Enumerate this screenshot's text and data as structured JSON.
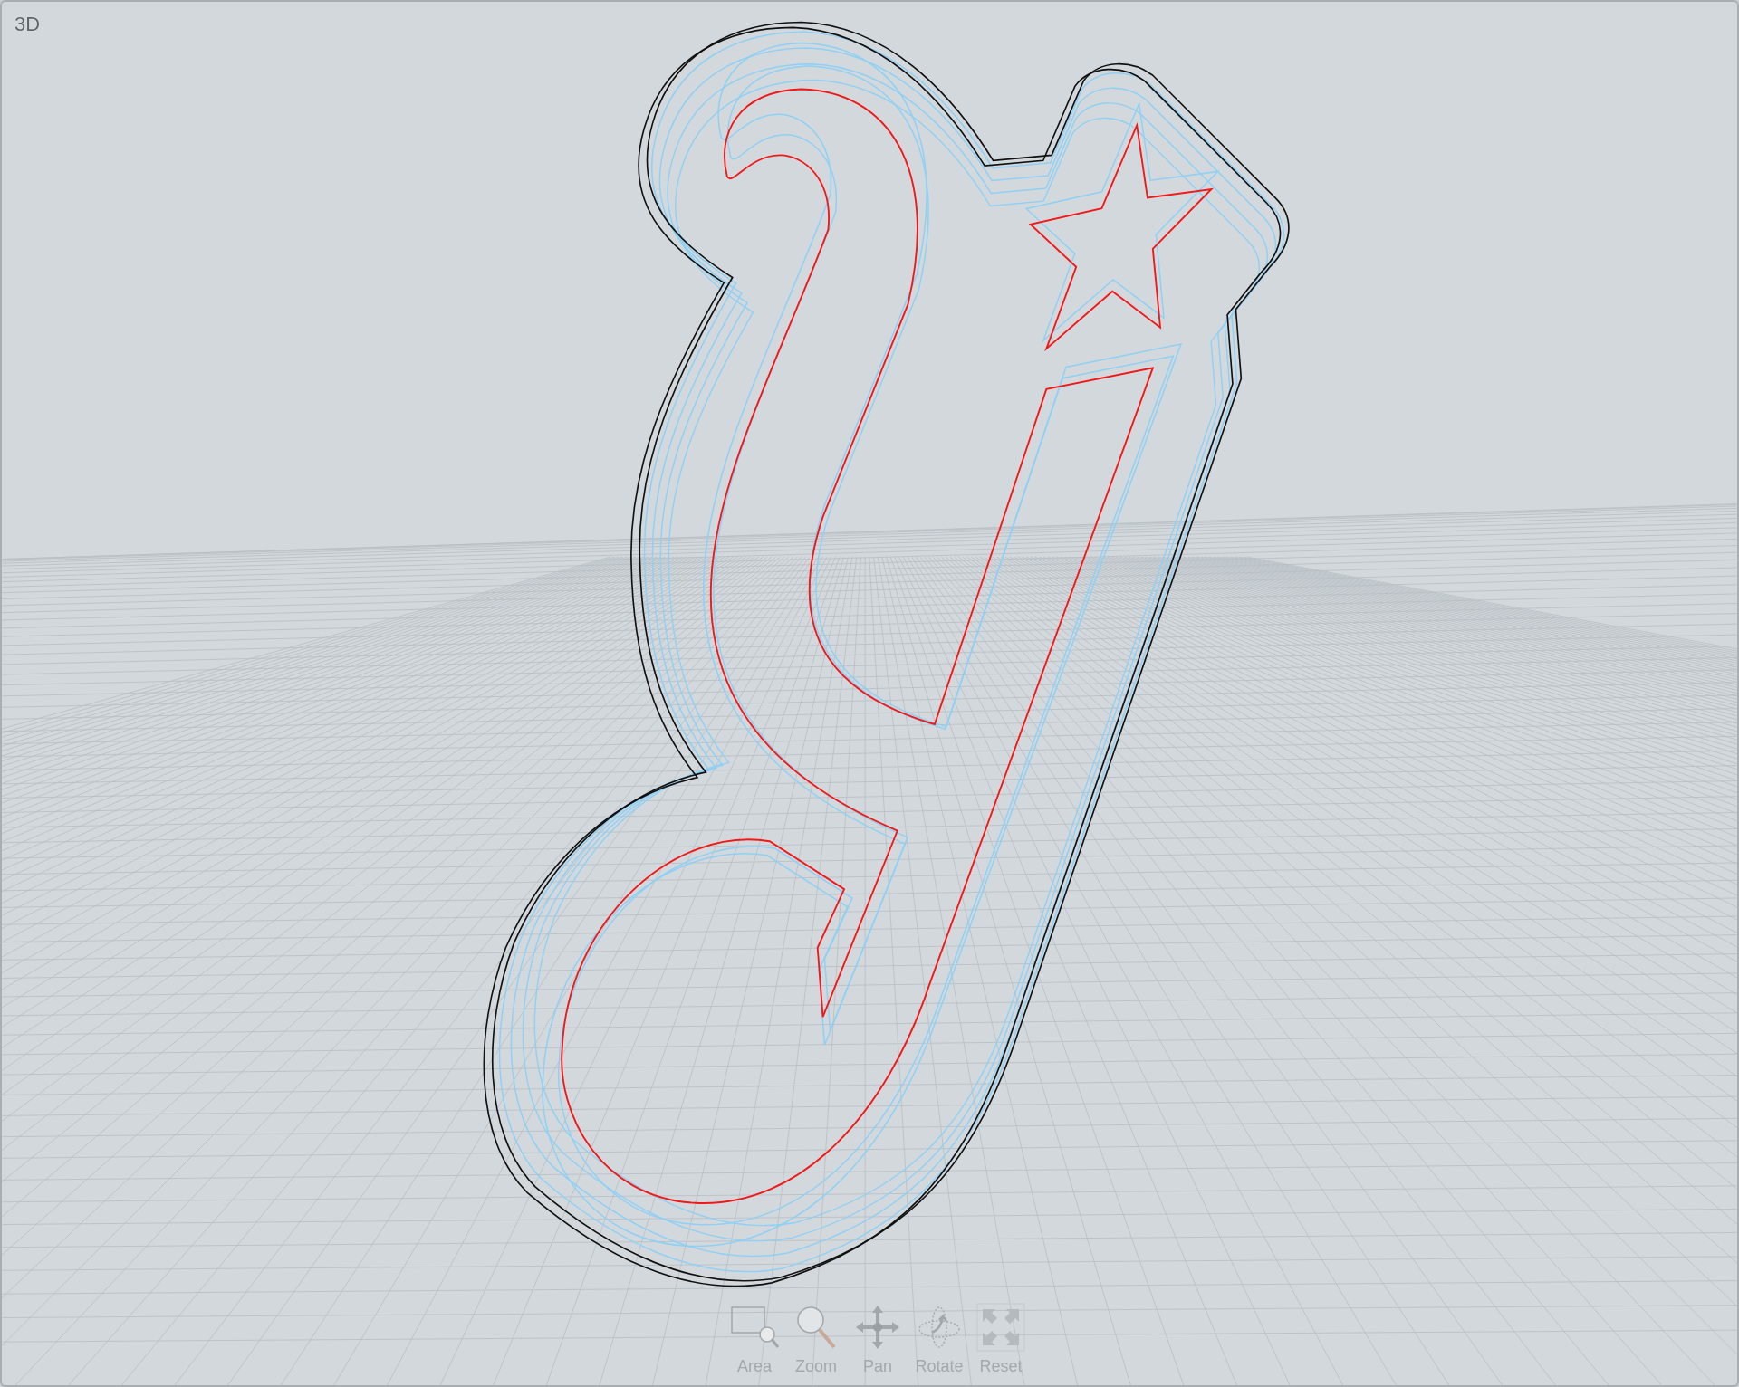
{
  "viewport": {
    "label": "3D"
  },
  "toolbar": [
    {
      "label": "Area",
      "kind": "area"
    },
    {
      "label": "Zoom",
      "kind": "zoom"
    },
    {
      "label": "Pan",
      "kind": "pan"
    },
    {
      "label": "Rotate",
      "kind": "rotate"
    },
    {
      "label": "Reset",
      "kind": "reset"
    }
  ]
}
